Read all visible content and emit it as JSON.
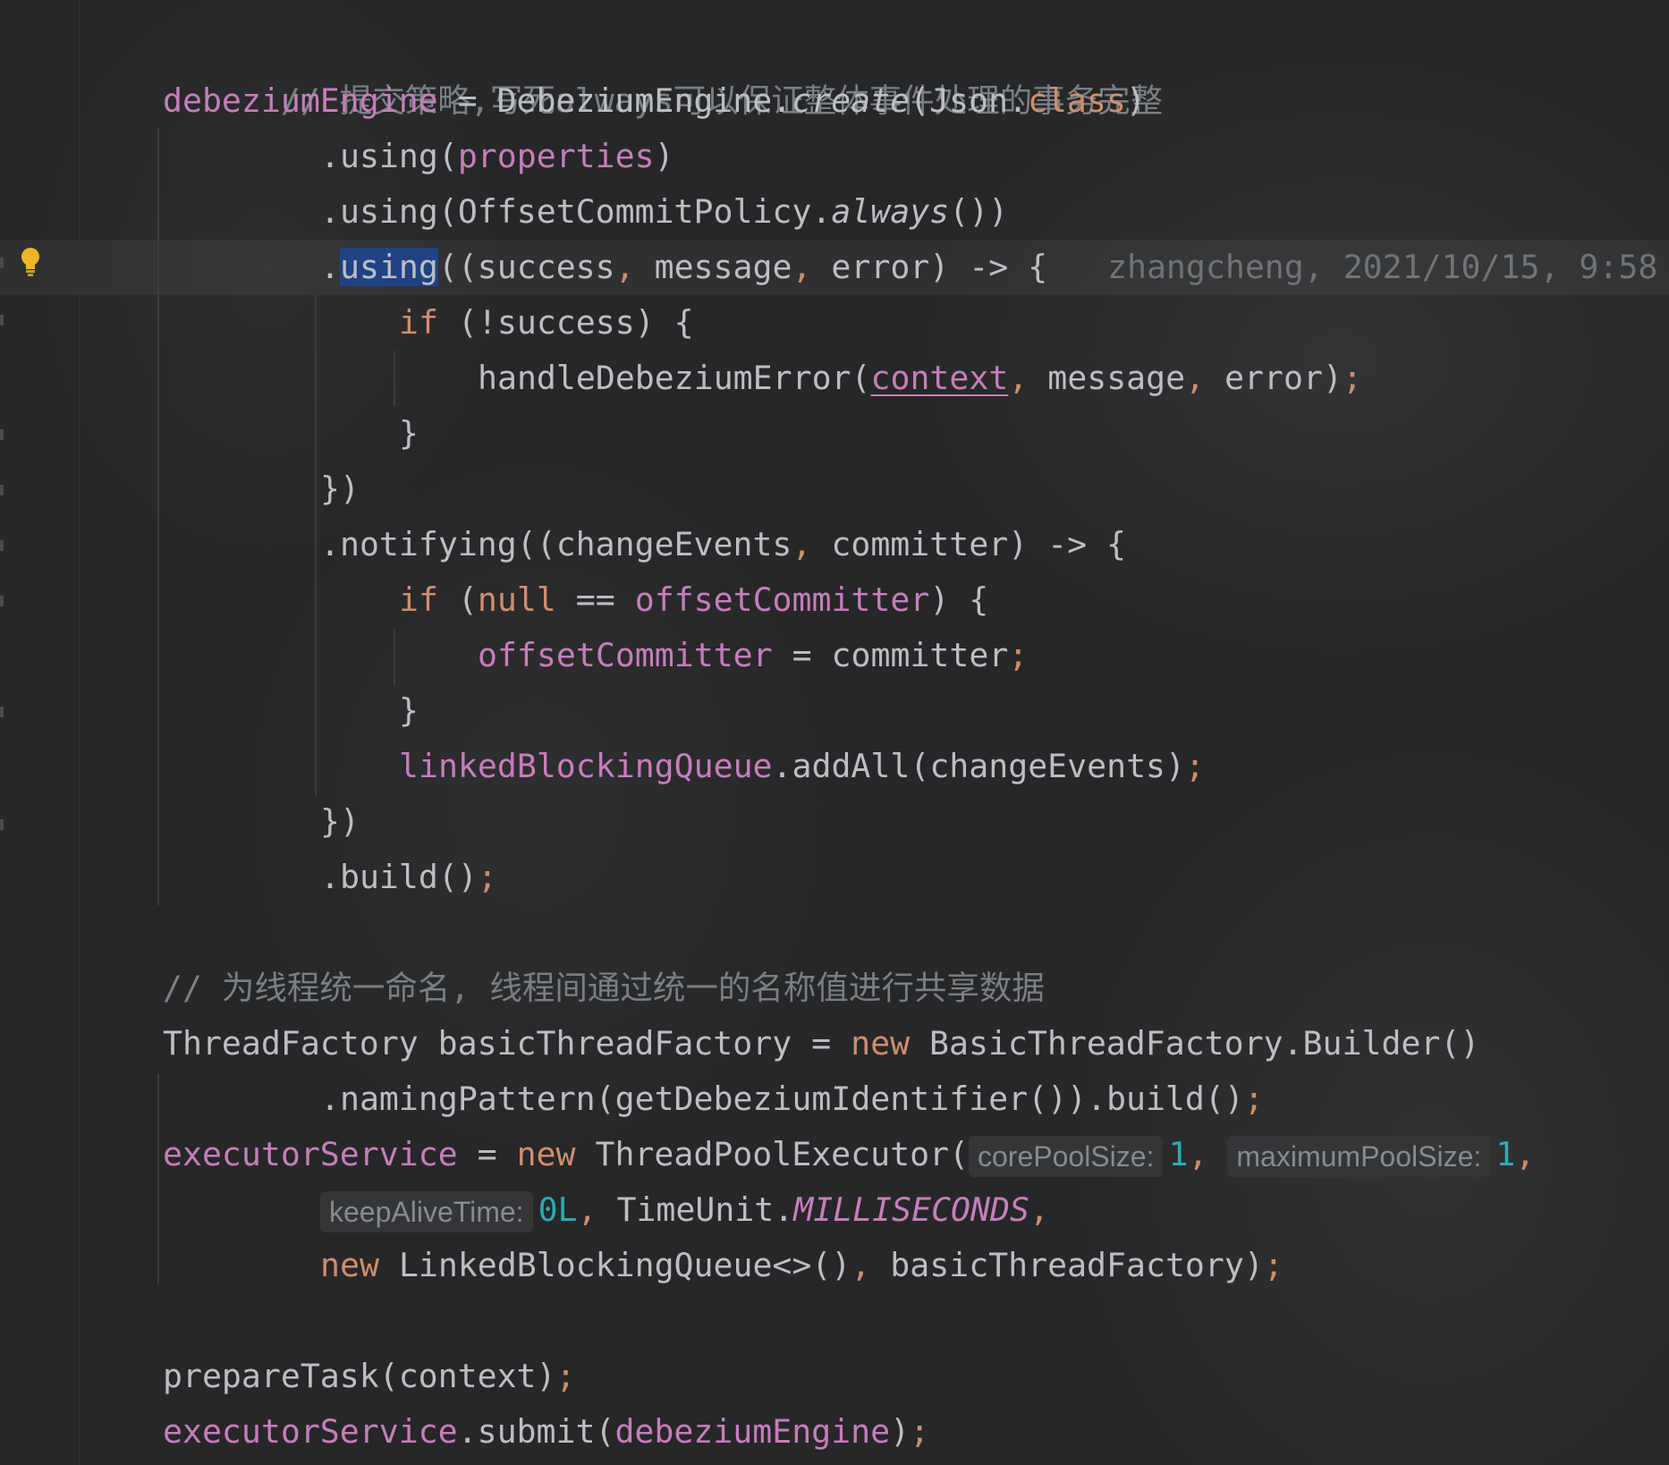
{
  "editor": {
    "theme_colors": {
      "background": "#262728",
      "comment": "#7a7e85",
      "field": "#c77dbb",
      "keyword": "#cf8e6d",
      "number": "#2aacb8",
      "text": "#bcbec4",
      "selection": "#214283"
    },
    "gutter": {
      "intention_icon": "lightbulb-icon"
    },
    "blame": "zhangcheng, 2021/10/15, 9:58",
    "lines": {
      "l1": {
        "comment": "// 提交策略,写死always可以保证整体事件处理的事务完整"
      },
      "l2": {
        "field": "debeziumEngine",
        "eq": " = DebeziumEngine.",
        "method": "create",
        "open": "(Json.",
        "kw": "class",
        "close": ")"
      },
      "l3": {
        "pre": ".using(",
        "field": "properties",
        "post": ")"
      },
      "l4": {
        "pre": ".using(OffsetCommitPolicy.",
        "method": "always",
        "post": "())"
      },
      "l5": {
        "dot": ".",
        "selected": "using",
        "p1": "((success",
        "c1": ",",
        "p2": " message",
        "c2": ",",
        "p3": " error) -> {"
      },
      "l6": {
        "kw": "if",
        "post": " (!success) {"
      },
      "l7": {
        "pre": "handleDebeziumError(",
        "field": "context",
        "c1": ",",
        "p2": " message",
        "c2": ",",
        "p3": " error)",
        "semi": ";"
      },
      "l8": {
        "text": "}"
      },
      "l9": {
        "text": "})"
      },
      "l10": {
        "pre": ".notifying((changeEvents",
        "c1": ",",
        "post": " committer) -> {"
      },
      "l11": {
        "kw": "if",
        "p1": " (",
        "kw2": "null",
        "p2": " == ",
        "field": "offsetCommitter",
        "p3": ") {"
      },
      "l12": {
        "field": "offsetCommitter",
        "post": " = committer",
        "semi": ";"
      },
      "l13": {
        "text": "}"
      },
      "l14": {
        "field": "linkedBlockingQueue",
        "post": ".addAll(changeEvents)",
        "semi": ";"
      },
      "l15": {
        "text": "})"
      },
      "l16": {
        "pre": ".build()",
        "semi": ";"
      },
      "l17": {
        "comment": "// 为线程统一命名, 线程间通过统一的名称值进行共享数据"
      },
      "l18": {
        "pre": "ThreadFactory basicThreadFactory = ",
        "kw": "new",
        "post": " BasicThreadFactory.Builder()"
      },
      "l19": {
        "pre": ".namingPattern(getDebeziumIdentifier()).build()",
        "semi": ";"
      },
      "l20": {
        "field": "executorService",
        "p1": " = ",
        "kw": "new",
        "p2": " ThreadPoolExecutor(",
        "hint1": "corePoolSize:",
        "n1": "1",
        "c1": ",",
        "hint2": "maximumPoolSize:",
        "n2": "1",
        "c2": ","
      },
      "l21": {
        "hint": "keepAliveTime:",
        "num": "0L",
        "c1": ",",
        "p1": " TimeUnit.",
        "static": "MILLISECONDS",
        "c2": ","
      },
      "l22": {
        "kw": "new",
        "p1": " LinkedBlockingQueue<>()",
        "c1": ",",
        "p2": " basicThreadFactory)",
        "semi": ";"
      },
      "l23": {
        "pre": "prepareTask(context)",
        "semi": ";"
      },
      "l24": {
        "field": "executorService",
        "p1": ".submit(",
        "field2": "debeziumEngine",
        "p2": ")",
        "semi": ";"
      }
    }
  }
}
